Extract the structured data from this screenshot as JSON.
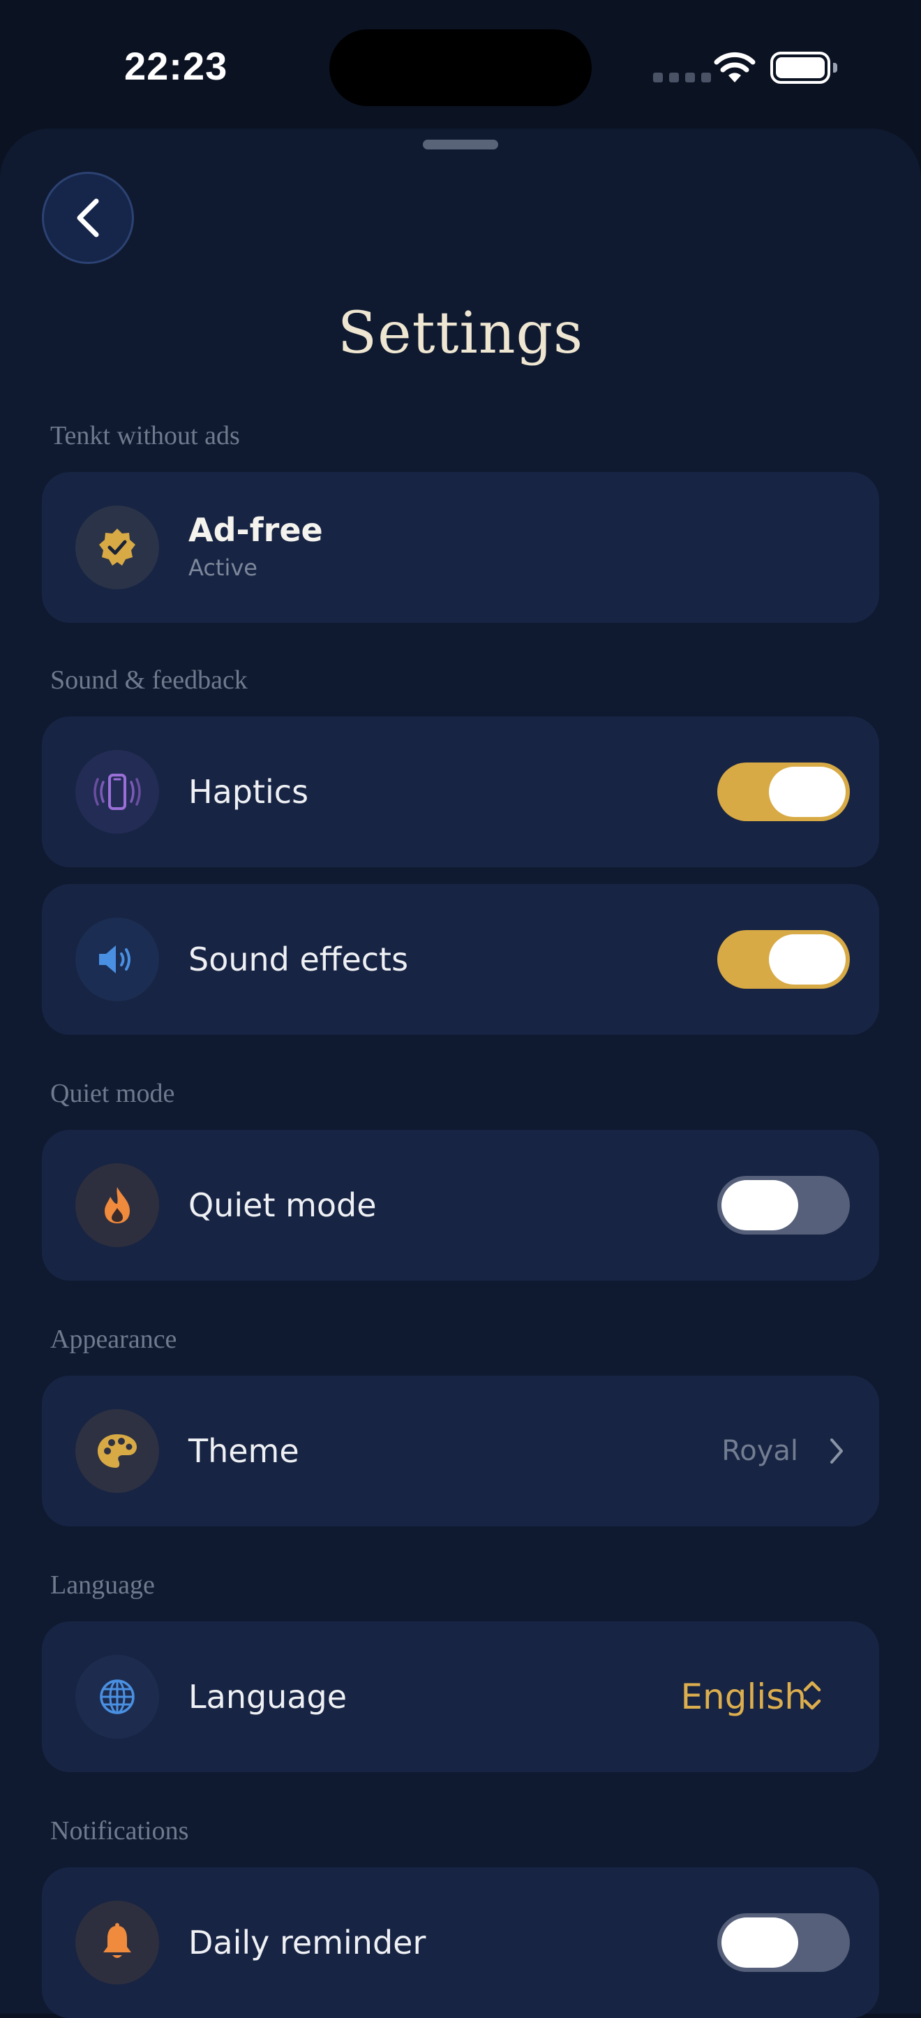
{
  "status_bar": {
    "time": "22:23"
  },
  "page": {
    "title": "Settings"
  },
  "sections": {
    "ads": {
      "label": "Tenkt without ads",
      "ad_free": {
        "title": "Ad-free",
        "subtitle": "Active"
      }
    },
    "sound": {
      "label": "Sound & feedback",
      "haptics": {
        "label": "Haptics",
        "enabled": true
      },
      "sound_effects": {
        "label": "Sound effects",
        "enabled": true
      }
    },
    "quiet": {
      "label": "Quiet mode",
      "quiet_mode": {
        "label": "Quiet mode",
        "enabled": false
      }
    },
    "appearance": {
      "label": "Appearance",
      "theme": {
        "label": "Theme",
        "value": "Royal"
      }
    },
    "language": {
      "label": "Language",
      "language": {
        "label": "Language",
        "value": "English"
      }
    },
    "notifications": {
      "label": "Notifications",
      "daily_reminder": {
        "label": "Daily reminder",
        "enabled": false
      }
    }
  },
  "colors": {
    "accent": "#d8aa45",
    "background": "#0f1a30",
    "card": "#172443",
    "toggle_off": "#56607a"
  }
}
